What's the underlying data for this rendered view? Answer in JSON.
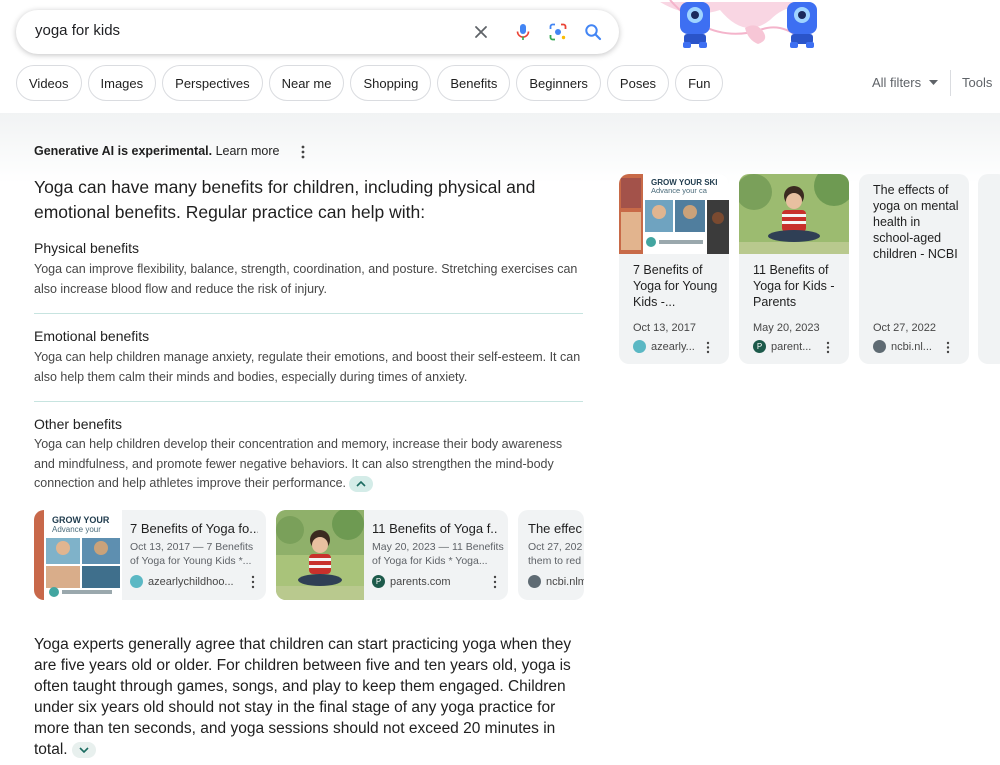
{
  "search": {
    "query": "yoga for kids"
  },
  "icons": {
    "clear": "close-icon",
    "voice": "mic-icon",
    "lens": "camera-lens-icon",
    "search": "search-icon"
  },
  "colors": {
    "accent_teal": "#1a9b8c",
    "chip_border": "#dadce0",
    "divider": "#c7e4e0",
    "card_bg": "#f1f3f4"
  },
  "chips": [
    "Videos",
    "Images",
    "Perspectives",
    "Near me",
    "Shopping",
    "Benefits",
    "Beginners",
    "Poses",
    "Fun"
  ],
  "filters": {
    "all_filters": "All filters",
    "tools": "Tools"
  },
  "ai": {
    "notice_bold": "Generative AI is experimental.",
    "notice_link": "Learn more",
    "lead": "Yoga can have many benefits for children, including physical and emotional benefits. Regular practice can help with:",
    "sections": [
      {
        "title": "Physical benefits",
        "body": "Yoga can improve flexibility, balance, strength, coordination, and posture. Stretching exercises can also increase blood flow and reduce the risk of injury."
      },
      {
        "title": "Emotional benefits",
        "body": "Yoga can help children manage anxiety, regulate their emotions, and boost their self-esteem. It can also help them calm their minds and bodies, especially during times of anxiety."
      },
      {
        "title": "Other benefits",
        "body": "Yoga can help children develop their concentration and memory, increase their body awareness and mindfulness, and promote fewer negative behaviors. It can also strengthen the mind-body connection and help athletes improve their performance."
      }
    ],
    "source_cards": [
      {
        "title": "7 Benefits of Yoga fo...",
        "snippet": "Oct 13, 2017 — 7 Benefits of Yoga for Young Kids *...",
        "source": "azearlychildhoo..."
      },
      {
        "title": "11 Benefits of Yoga f...",
        "snippet": "May 20, 2023 — 11 Benefits of Yoga for Kids * Yoga...",
        "source": "parents.com"
      },
      {
        "title": "The effec",
        "snippet": "Oct 27, 202 them to red",
        "source": "ncbi.nlm"
      }
    ],
    "final": "Yoga experts generally agree that children can start practicing yoga when they are five years old or older. For children between five and ten years old, yoga is often taught through games, songs, and play to keep them engaged. Children under six years old should not stay in the final stage of any yoga practice for more than ten seconds, and yoga sessions should not exceed 20 minutes in total.",
    "thumb_text": {
      "grow": "GROW YOUR SKI",
      "grow_short": "GROW YOUR",
      "advance": "Advance your ca",
      "advance_short": "Advance your"
    }
  },
  "right_cards": [
    {
      "title": "7 Benefits of Yoga for Young Kids -...",
      "date": "Oct 13, 2017",
      "source": "azearly..."
    },
    {
      "title": "11 Benefits of Yoga for Kids - Parents",
      "date": "May 20, 2023",
      "source": "parent..."
    },
    {
      "title": "The effects of yoga on mental health in school-aged children - NCBI",
      "date": "Oct 27, 2022",
      "source": "ncbi.nl..."
    }
  ]
}
